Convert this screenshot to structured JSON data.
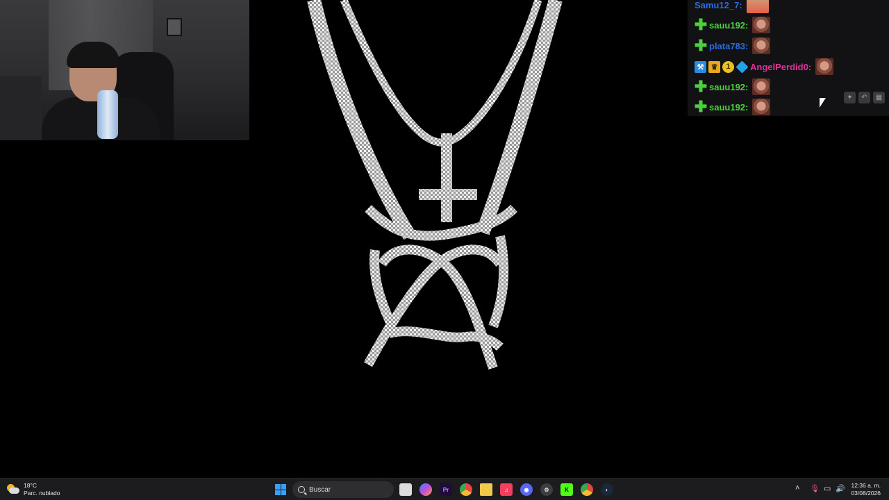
{
  "chat": {
    "messages": [
      {
        "user": "Samu12_7:",
        "color": "#2d6be0",
        "badges": []
      },
      {
        "user": "sauu192:",
        "color": "#4ad23a",
        "badges": [
          "plus-badge"
        ]
      },
      {
        "user": "plata783:",
        "color": "#2d6be0",
        "badges": [
          "plus-badge"
        ]
      },
      {
        "user": "AngelPerdid0:",
        "color": "#e0309a",
        "badges": [
          "hammer-badge",
          "crown-badge",
          "one-badge",
          "gem-badge"
        ]
      },
      {
        "user": "sauu192:",
        "color": "#4ad23a",
        "badges": [
          "plus-badge"
        ]
      },
      {
        "user": "sauu192:",
        "color": "#4ad23a",
        "badges": [
          "plus-badge"
        ]
      }
    ]
  },
  "taskbar": {
    "weather": {
      "temp": "18°C",
      "condition": "Parc. nublado"
    },
    "search_placeholder": "Buscar",
    "apps": [
      "file-explorer-window-icon",
      "copilot-icon",
      "premiere-pro-icon",
      "chrome-icon",
      "folder-icon",
      "music-icon",
      "discord-icon",
      "settings-icon",
      "kick-icon",
      "chrome-alt-icon",
      "steam-icon"
    ],
    "app_labels": {
      "premiere": "Pr"
    },
    "clock": {
      "time": "12:36 a. m.",
      "date": "03/08/2026"
    }
  },
  "colors": {
    "chat_bg": "#141416",
    "taskbar_bg": "#1c1c1e",
    "accent": "#3aa0f5"
  }
}
